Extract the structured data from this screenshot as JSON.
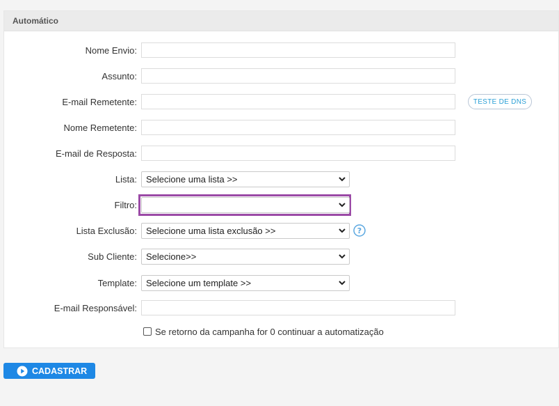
{
  "panel": {
    "title": "Automático"
  },
  "fields": {
    "nome_envio": {
      "label": "Nome Envio:",
      "value": ""
    },
    "assunto": {
      "label": "Assunto:",
      "value": ""
    },
    "email_remetente": {
      "label": "E-mail Remetente:",
      "value": ""
    },
    "nome_remetente": {
      "label": "Nome Remetente:",
      "value": ""
    },
    "email_resposta": {
      "label": "E-mail de Resposta:",
      "value": ""
    },
    "lista": {
      "label": "Lista:",
      "selected": "Selecione uma lista >>"
    },
    "filtro": {
      "label": "Filtro:",
      "selected": ""
    },
    "lista_exclusao": {
      "label": "Lista Exclusão:",
      "selected": "Selecione uma lista exclusão >>"
    },
    "sub_cliente": {
      "label": "Sub Cliente:",
      "selected": "Selecione>>"
    },
    "template": {
      "label": "Template:",
      "selected": "Selecione um template >>"
    },
    "email_responsavel": {
      "label": "E-mail Responsável:",
      "value": ""
    }
  },
  "dns_button": {
    "label": "TESTE DE DNS"
  },
  "checkbox": {
    "label": "Se retorno da campanha for 0 continuar a automatização",
    "checked": false
  },
  "submit": {
    "label": "CADASTRAR"
  },
  "icons": {
    "help": "question-circle-icon",
    "play": "play-circle-icon",
    "chevron": "chevron-down-icon"
  },
  "colors": {
    "accent": "#1e88e5",
    "focus": "#9b4aa6",
    "link": "#2a9fd6",
    "help": "#5aa7e0"
  }
}
